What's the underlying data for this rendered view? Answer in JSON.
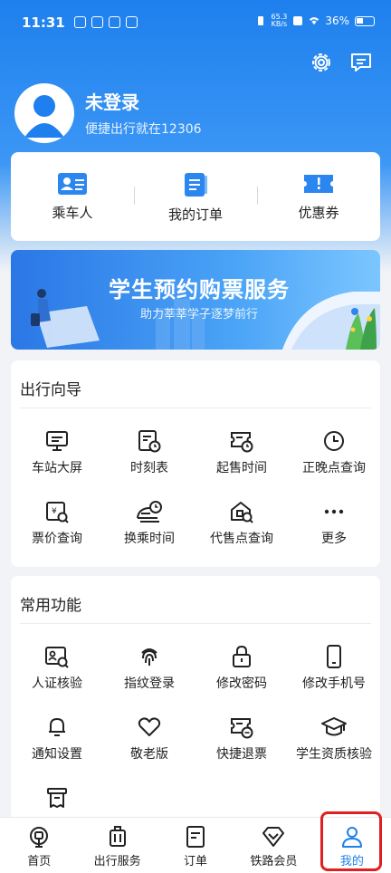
{
  "status_bar": {
    "time": "11:31",
    "speed_top": "65.3",
    "speed_bottom": "KB/s",
    "battery": "36%"
  },
  "header": {
    "settings_icon": "gear-icon",
    "message_icon": "message-icon",
    "user_name": "未登录",
    "user_sub": "便捷出行就在12306"
  },
  "quick_actions": [
    {
      "label": "乘车人",
      "icon": "passenger-card-icon"
    },
    {
      "label": "我的订单",
      "icon": "order-list-icon"
    },
    {
      "label": "优惠券",
      "icon": "coupon-icon"
    }
  ],
  "banner": {
    "title": "学生预约购票服务",
    "subtitle": "助力莘莘学子逐梦前行"
  },
  "travel_guide": {
    "title": "出行向导",
    "items": [
      {
        "label": "车站大屏",
        "icon": "station-screen-icon"
      },
      {
        "label": "时刻表",
        "icon": "timetable-icon"
      },
      {
        "label": "起售时间",
        "icon": "ticket-time-icon"
      },
      {
        "label": "正晚点查询",
        "icon": "clock-icon"
      },
      {
        "label": "票价查询",
        "icon": "fare-search-icon"
      },
      {
        "label": "换乘时间",
        "icon": "train-clock-icon"
      },
      {
        "label": "代售点查询",
        "icon": "agency-search-icon"
      },
      {
        "label": "更多",
        "icon": "more-icon"
      }
    ]
  },
  "common_functions": {
    "title": "常用功能",
    "items": [
      {
        "label": "人证核验",
        "icon": "id-verify-icon"
      },
      {
        "label": "指纹登录",
        "icon": "fingerprint-icon"
      },
      {
        "label": "修改密码",
        "icon": "lock-icon"
      },
      {
        "label": "修改手机号",
        "icon": "phone-icon"
      },
      {
        "label": "通知设置",
        "icon": "bell-icon"
      },
      {
        "label": "敬老版",
        "icon": "heart-icon"
      },
      {
        "label": "快捷退票",
        "icon": "refund-ticket-icon"
      },
      {
        "label": "学生资质核验",
        "icon": "graduation-cap-icon"
      }
    ]
  },
  "tabbar": [
    {
      "label": "首页",
      "icon": "home-train-icon",
      "active": false
    },
    {
      "label": "出行服务",
      "icon": "luggage-icon",
      "active": false
    },
    {
      "label": "订单",
      "icon": "order-icon",
      "active": false
    },
    {
      "label": "铁路会员",
      "icon": "diamond-icon",
      "active": false
    },
    {
      "label": "我的",
      "icon": "person-icon",
      "active": true
    }
  ],
  "colors": {
    "primary": "#1e80ee",
    "highlight": "#e02020"
  }
}
